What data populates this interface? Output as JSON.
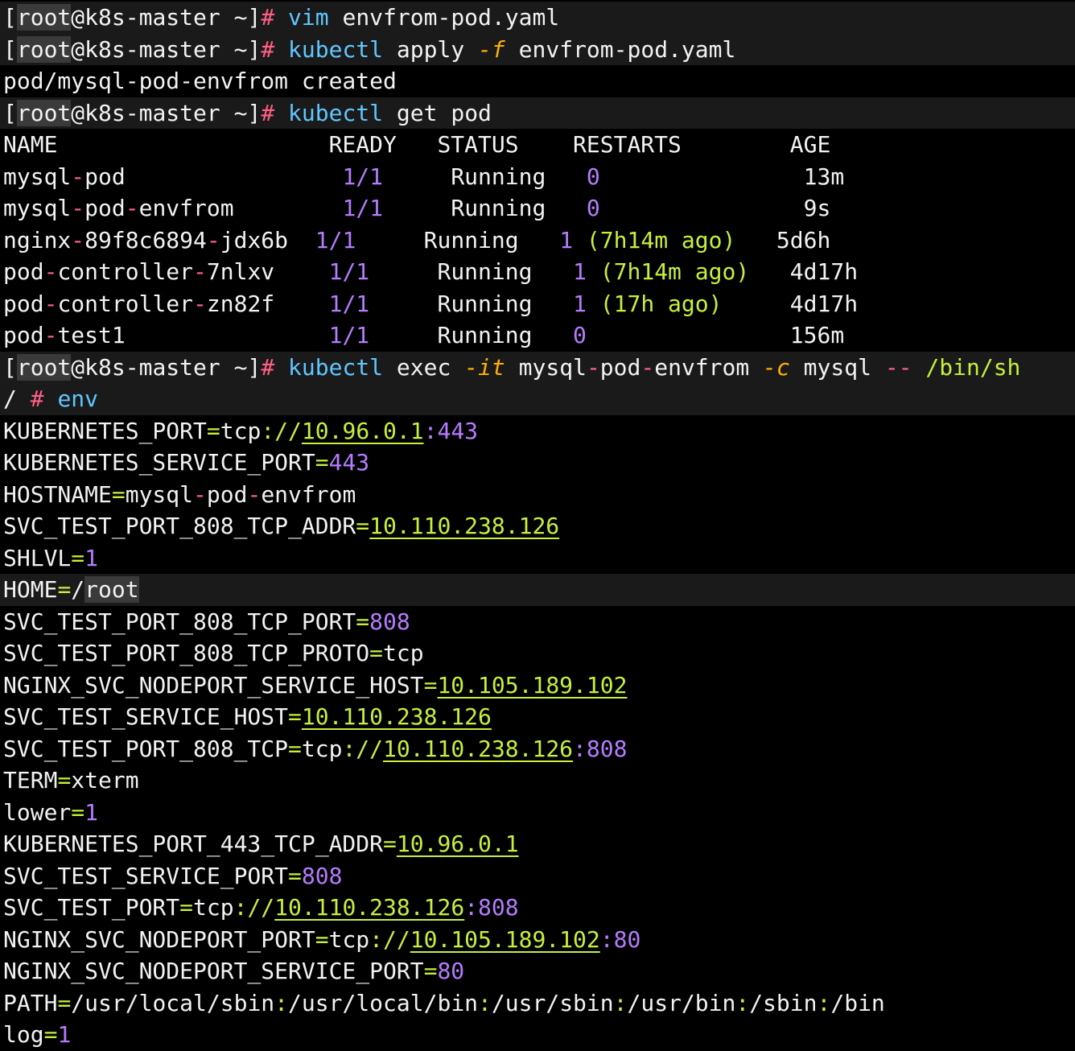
{
  "terminal": {
    "lines": [
      {
        "type": "prompt",
        "segments": [
          {
            "t": "[",
            "c": "plain"
          },
          {
            "t": "root",
            "c": "root"
          },
          {
            "t": "@k8s-master ~]",
            "c": "plain"
          },
          {
            "t": "#",
            "c": "sym"
          },
          {
            "t": " ",
            "c": "plain"
          },
          {
            "t": "vim",
            "c": "cmd"
          },
          {
            "t": " envfrom-pod.yaml",
            "c": "plain"
          }
        ]
      },
      {
        "type": "prompt",
        "segments": [
          {
            "t": "[",
            "c": "plain"
          },
          {
            "t": "root",
            "c": "root"
          },
          {
            "t": "@k8s-master ~]",
            "c": "plain"
          },
          {
            "t": "#",
            "c": "sym"
          },
          {
            "t": " ",
            "c": "plain"
          },
          {
            "t": "kubectl",
            "c": "cmd"
          },
          {
            "t": " apply ",
            "c": "plain"
          },
          {
            "t": "-f",
            "c": "flag"
          },
          {
            "t": " envfrom-pod.yaml",
            "c": "plain"
          }
        ]
      },
      {
        "type": "output",
        "segments": [
          {
            "t": "pod/mysql-pod-envfrom created",
            "c": "plain"
          }
        ]
      },
      {
        "type": "prompt",
        "segments": [
          {
            "t": "[",
            "c": "plain"
          },
          {
            "t": "root",
            "c": "root"
          },
          {
            "t": "@k8s-master ~]",
            "c": "plain"
          },
          {
            "t": "#",
            "c": "sym"
          },
          {
            "t": " ",
            "c": "plain"
          },
          {
            "t": "kubectl",
            "c": "cmd"
          },
          {
            "t": " get pod",
            "c": "plain"
          }
        ]
      },
      {
        "type": "output",
        "segments": [
          {
            "t": "NAME                    READY   STATUS    RESTARTS        AGE",
            "c": "plain"
          }
        ]
      },
      {
        "type": "output",
        "segments": [
          {
            "t": "mysql",
            "c": "plain"
          },
          {
            "t": "-",
            "c": "sym"
          },
          {
            "t": "pod                ",
            "c": "plain"
          },
          {
            "t": "1/1",
            "c": "num"
          },
          {
            "t": "     Running   ",
            "c": "plain"
          },
          {
            "t": "0",
            "c": "num"
          },
          {
            "t": "               13m",
            "c": "plain"
          }
        ]
      },
      {
        "type": "output",
        "segments": [
          {
            "t": "mysql",
            "c": "plain"
          },
          {
            "t": "-",
            "c": "sym"
          },
          {
            "t": "pod",
            "c": "plain"
          },
          {
            "t": "-",
            "c": "sym"
          },
          {
            "t": "envfrom        ",
            "c": "plain"
          },
          {
            "t": "1/1",
            "c": "num"
          },
          {
            "t": "     Running   ",
            "c": "plain"
          },
          {
            "t": "0",
            "c": "num"
          },
          {
            "t": "               9s",
            "c": "plain"
          }
        ]
      },
      {
        "type": "output",
        "segments": [
          {
            "t": "nginx",
            "c": "plain"
          },
          {
            "t": "-",
            "c": "sym"
          },
          {
            "t": "89f8c6894",
            "c": "plain"
          },
          {
            "t": "-",
            "c": "sym"
          },
          {
            "t": "jdx6b  ",
            "c": "plain"
          },
          {
            "t": "1/1",
            "c": "num"
          },
          {
            "t": "     Running   ",
            "c": "plain"
          },
          {
            "t": "1",
            "c": "num"
          },
          {
            "t": " ",
            "c": "plain"
          },
          {
            "t": "(7h14m ago)",
            "c": "path"
          },
          {
            "t": "   5d6h",
            "c": "plain"
          }
        ]
      },
      {
        "type": "output",
        "segments": [
          {
            "t": "pod",
            "c": "plain"
          },
          {
            "t": "-",
            "c": "sym"
          },
          {
            "t": "controller",
            "c": "plain"
          },
          {
            "t": "-",
            "c": "sym"
          },
          {
            "t": "7nlxv    ",
            "c": "plain"
          },
          {
            "t": "1/1",
            "c": "num"
          },
          {
            "t": "     Running   ",
            "c": "plain"
          },
          {
            "t": "1",
            "c": "num"
          },
          {
            "t": " ",
            "c": "plain"
          },
          {
            "t": "(7h14m ago)",
            "c": "path"
          },
          {
            "t": "   4d17h",
            "c": "plain"
          }
        ]
      },
      {
        "type": "output",
        "segments": [
          {
            "t": "pod",
            "c": "plain"
          },
          {
            "t": "-",
            "c": "sym"
          },
          {
            "t": "controller",
            "c": "plain"
          },
          {
            "t": "-",
            "c": "sym"
          },
          {
            "t": "zn82f    ",
            "c": "plain"
          },
          {
            "t": "1/1",
            "c": "num"
          },
          {
            "t": "     Running   ",
            "c": "plain"
          },
          {
            "t": "1",
            "c": "num"
          },
          {
            "t": " ",
            "c": "plain"
          },
          {
            "t": "(17h ago)",
            "c": "path"
          },
          {
            "t": "     4d17h",
            "c": "plain"
          }
        ]
      },
      {
        "type": "output",
        "segments": [
          {
            "t": "pod",
            "c": "plain"
          },
          {
            "t": "-",
            "c": "sym"
          },
          {
            "t": "test1               ",
            "c": "plain"
          },
          {
            "t": "1/1",
            "c": "num"
          },
          {
            "t": "     Running   ",
            "c": "plain"
          },
          {
            "t": "0",
            "c": "num"
          },
          {
            "t": "               156m",
            "c": "plain"
          }
        ]
      },
      {
        "type": "prompt",
        "segments": [
          {
            "t": "[",
            "c": "plain"
          },
          {
            "t": "root",
            "c": "root"
          },
          {
            "t": "@k8s-master ~]",
            "c": "plain"
          },
          {
            "t": "#",
            "c": "sym"
          },
          {
            "t": " ",
            "c": "plain"
          },
          {
            "t": "kubectl",
            "c": "cmd"
          },
          {
            "t": " exec ",
            "c": "plain"
          },
          {
            "t": "-it",
            "c": "flag"
          },
          {
            "t": " mysql",
            "c": "plain"
          },
          {
            "t": "-",
            "c": "sym"
          },
          {
            "t": "pod",
            "c": "plain"
          },
          {
            "t": "-",
            "c": "sym"
          },
          {
            "t": "envfrom ",
            "c": "plain"
          },
          {
            "t": "-c",
            "c": "flag"
          },
          {
            "t": " mysql ",
            "c": "plain"
          },
          {
            "t": "--",
            "c": "sym"
          },
          {
            "t": " ",
            "c": "plain"
          },
          {
            "t": "/bin/sh",
            "c": "path"
          }
        ]
      },
      {
        "type": "prompt",
        "segments": [
          {
            "t": "/ ",
            "c": "plain"
          },
          {
            "t": "#",
            "c": "sym"
          },
          {
            "t": " ",
            "c": "plain"
          },
          {
            "t": "env",
            "c": "cmd"
          }
        ]
      },
      {
        "type": "output",
        "segments": [
          {
            "t": "KUBERNETES_PORT",
            "c": "plain"
          },
          {
            "t": "=",
            "c": "path"
          },
          {
            "t": "tcp",
            "c": "plain"
          },
          {
            "t": "://",
            "c": "path"
          },
          {
            "t": "10.96.0.1",
            "c": "ip"
          },
          {
            "t": ":443",
            "c": "num"
          }
        ]
      },
      {
        "type": "output",
        "segments": [
          {
            "t": "KUBERNETES_SERVICE_PORT",
            "c": "plain"
          },
          {
            "t": "=",
            "c": "path"
          },
          {
            "t": "443",
            "c": "num"
          }
        ]
      },
      {
        "type": "output",
        "segments": [
          {
            "t": "HOSTNAME",
            "c": "plain"
          },
          {
            "t": "=",
            "c": "path"
          },
          {
            "t": "mysql",
            "c": "plain"
          },
          {
            "t": "-",
            "c": "sym"
          },
          {
            "t": "pod",
            "c": "plain"
          },
          {
            "t": "-",
            "c": "sym"
          },
          {
            "t": "envfrom",
            "c": "plain"
          }
        ]
      },
      {
        "type": "output",
        "segments": [
          {
            "t": "SVC_TEST_PORT_808_TCP_ADDR",
            "c": "plain"
          },
          {
            "t": "=",
            "c": "path"
          },
          {
            "t": "10.110.238.126",
            "c": "ip"
          }
        ]
      },
      {
        "type": "output",
        "segments": [
          {
            "t": "SHLVL",
            "c": "plain"
          },
          {
            "t": "=",
            "c": "path"
          },
          {
            "t": "1",
            "c": "num"
          }
        ]
      },
      {
        "type": "hl",
        "segments": [
          {
            "t": "HOME",
            "c": "plain"
          },
          {
            "t": "=",
            "c": "path"
          },
          {
            "t": "/",
            "c": "plain"
          },
          {
            "t": "root",
            "c": "root"
          }
        ]
      },
      {
        "type": "output",
        "segments": [
          {
            "t": "SVC_TEST_PORT_808_TCP_PORT",
            "c": "plain"
          },
          {
            "t": "=",
            "c": "path"
          },
          {
            "t": "808",
            "c": "num"
          }
        ]
      },
      {
        "type": "output",
        "segments": [
          {
            "t": "SVC_TEST_PORT_808_TCP_PROTO",
            "c": "plain"
          },
          {
            "t": "=",
            "c": "path"
          },
          {
            "t": "tcp",
            "c": "plain"
          }
        ]
      },
      {
        "type": "output",
        "segments": [
          {
            "t": "NGINX_SVC_NODEPORT_SERVICE_HOST",
            "c": "plain"
          },
          {
            "t": "=",
            "c": "path"
          },
          {
            "t": "10.105.189.102",
            "c": "ip"
          }
        ]
      },
      {
        "type": "output",
        "segments": [
          {
            "t": "SVC_TEST_SERVICE_HOST",
            "c": "plain"
          },
          {
            "t": "=",
            "c": "path"
          },
          {
            "t": "10.110.238.126",
            "c": "ip"
          }
        ]
      },
      {
        "type": "output",
        "segments": [
          {
            "t": "SVC_TEST_PORT_808_TCP",
            "c": "plain"
          },
          {
            "t": "=",
            "c": "path"
          },
          {
            "t": "tcp",
            "c": "plain"
          },
          {
            "t": "://",
            "c": "path"
          },
          {
            "t": "10.110.238.126",
            "c": "ip"
          },
          {
            "t": ":808",
            "c": "num"
          }
        ]
      },
      {
        "type": "output",
        "segments": [
          {
            "t": "TERM",
            "c": "plain"
          },
          {
            "t": "=",
            "c": "path"
          },
          {
            "t": "xterm",
            "c": "plain"
          }
        ]
      },
      {
        "type": "output",
        "segments": [
          {
            "t": "lower",
            "c": "plain"
          },
          {
            "t": "=",
            "c": "path"
          },
          {
            "t": "1",
            "c": "num"
          }
        ]
      },
      {
        "type": "output",
        "segments": [
          {
            "t": "KUBERNETES_PORT_443_TCP_ADDR",
            "c": "plain"
          },
          {
            "t": "=",
            "c": "path"
          },
          {
            "t": "10.96.0.1",
            "c": "ip"
          }
        ]
      },
      {
        "type": "output",
        "segments": [
          {
            "t": "SVC_TEST_SERVICE_PORT",
            "c": "plain"
          },
          {
            "t": "=",
            "c": "path"
          },
          {
            "t": "808",
            "c": "num"
          }
        ]
      },
      {
        "type": "output",
        "segments": [
          {
            "t": "SVC_TEST_PORT",
            "c": "plain"
          },
          {
            "t": "=",
            "c": "path"
          },
          {
            "t": "tcp",
            "c": "plain"
          },
          {
            "t": "://",
            "c": "path"
          },
          {
            "t": "10.110.238.126",
            "c": "ip"
          },
          {
            "t": ":808",
            "c": "num"
          }
        ]
      },
      {
        "type": "output",
        "segments": [
          {
            "t": "NGINX_SVC_NODEPORT_PORT",
            "c": "plain"
          },
          {
            "t": "=",
            "c": "path"
          },
          {
            "t": "tcp",
            "c": "plain"
          },
          {
            "t": "://",
            "c": "path"
          },
          {
            "t": "10.105.189.102",
            "c": "ip"
          },
          {
            "t": ":80",
            "c": "num"
          }
        ]
      },
      {
        "type": "output",
        "segments": [
          {
            "t": "NGINX_SVC_NODEPORT_SERVICE_PORT",
            "c": "plain"
          },
          {
            "t": "=",
            "c": "path"
          },
          {
            "t": "80",
            "c": "num"
          }
        ]
      },
      {
        "type": "output",
        "segments": [
          {
            "t": "PATH",
            "c": "plain"
          },
          {
            "t": "=",
            "c": "path"
          },
          {
            "t": "/usr/local/sbin",
            "c": "plain"
          },
          {
            "t": ":",
            "c": "path"
          },
          {
            "t": "/usr/local/bin",
            "c": "plain"
          },
          {
            "t": ":",
            "c": "path"
          },
          {
            "t": "/usr/sbin",
            "c": "plain"
          },
          {
            "t": ":",
            "c": "path"
          },
          {
            "t": "/usr/bin",
            "c": "plain"
          },
          {
            "t": ":",
            "c": "path"
          },
          {
            "t": "/sbin",
            "c": "plain"
          },
          {
            "t": ":",
            "c": "path"
          },
          {
            "t": "/bin",
            "c": "plain"
          }
        ]
      },
      {
        "type": "output",
        "segments": [
          {
            "t": "log",
            "c": "plain"
          },
          {
            "t": "=",
            "c": "path"
          },
          {
            "t": "1",
            "c": "num"
          }
        ]
      }
    ]
  },
  "colors": {
    "background": "#000000",
    "text": "#f2f2f2",
    "prompt_hash": "#ff5f87",
    "command": "#5fc7ff",
    "flag": "#ffb000",
    "number": "#b57cff",
    "path_value": "#c6f03c",
    "line_highlight": "#1a1a1a"
  }
}
